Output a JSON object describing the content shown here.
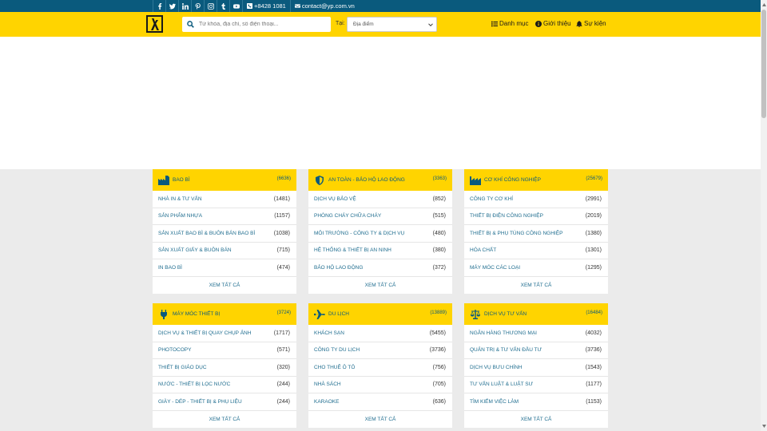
{
  "topbar": {
    "icons": [
      "facebook-icon",
      "twitter-icon",
      "linkedin-icon",
      "pinterest-icon",
      "instagram-icon",
      "tumblr-icon",
      "youtube-icon"
    ],
    "phone": "+8428 1081",
    "email": "contact@yp.com.vn",
    "bg_color": "#0a5a7d"
  },
  "header": {
    "bg_color": "#ffd400",
    "search_placeholder": "Từ khóa, địa chỉ, số điện thoại...",
    "location_label": "Tại:",
    "location_value": "Địa điểm",
    "nav": {
      "categories": "Danh mục",
      "about": "Giới thiệu",
      "events": "Sự kiện"
    }
  },
  "categories": [
    {
      "title": "BAO BÌ",
      "total": "(6636)",
      "icon": "factory-icon",
      "items": [
        {
          "label": "NHÀ IN & TƯ VẤN",
          "count": "(1481)"
        },
        {
          "label": "SẢN PHẨM NHỰA",
          "count": "(1157)"
        },
        {
          "label": "SẢN XUẤT BAO BÌ & BUÔN BÁN BAO BÌ",
          "count": "(1038)"
        },
        {
          "label": "SẢN XUẤT GIẤY & BUÔN BÁN",
          "count": "(715)"
        },
        {
          "label": "IN BAO BÌ",
          "count": "(474)"
        }
      ],
      "see_all": "XEM TẤT CẢ"
    },
    {
      "title": "AN TOÀN - BẢO HỘ LAO ĐỘNG",
      "total": "(3363)",
      "icon": "shield-icon",
      "items": [
        {
          "label": "DỊCH VỤ BẢO VỆ",
          "count": "(852)"
        },
        {
          "label": "PHÒNG CHÁY CHỮA CHÁY",
          "count": "(515)"
        },
        {
          "label": "MÔI TRƯỜNG - CÔNG TY & DỊCH VỤ",
          "count": "(480)"
        },
        {
          "label": "HỆ THỐNG & THIẾT BỊ AN NINH",
          "count": "(380)"
        },
        {
          "label": "BẢO HỘ LAO ĐỘNG",
          "count": "(372)"
        }
      ],
      "see_all": "XEM TẤT CẢ"
    },
    {
      "title": "CƠ KHÍ CÔNG NGHIỆP",
      "total": "(25679)",
      "icon": "industry-icon",
      "items": [
        {
          "label": "CÔNG TY CƠ KHÍ",
          "count": "(2991)"
        },
        {
          "label": "THIẾT BỊ ĐIỆN CÔNG NGHIỆP",
          "count": "(2019)"
        },
        {
          "label": "THIẾT BỊ & PHỤ TÙNG CÔNG NGHIỆP",
          "count": "(1380)"
        },
        {
          "label": "HÓA CHẤT",
          "count": "(1301)"
        },
        {
          "label": "MÁY MÓC CÁC LOẠI",
          "count": "(1295)"
        }
      ],
      "see_all": "XEM TẤT CẢ"
    },
    {
      "title": "MÁY MÓC THIẾT BỊ",
      "total": "(3724)",
      "icon": "plug-icon",
      "items": [
        {
          "label": "DỊCH VỤ & THIẾT BỊ QUAY CHỤP ẢNH",
          "count": "(1717)"
        },
        {
          "label": "PHOTOCOPY",
          "count": "(571)"
        },
        {
          "label": "THIẾT BỊ GIÁO DỤC",
          "count": "(320)"
        },
        {
          "label": "NƯỚC - THIẾT BỊ LỌC NƯỚC",
          "count": "(244)"
        },
        {
          "label": "GIÀY - DÉP - THIẾT BỊ & PHỤ LIỆU",
          "count": "(244)"
        }
      ],
      "see_all": "XEM TẤT CẢ"
    },
    {
      "title": "DU LỊCH",
      "total": "(13889)",
      "icon": "plane-icon",
      "items": [
        {
          "label": "KHÁCH SẠN",
          "count": "(5455)"
        },
        {
          "label": "CÔNG TY DU LỊCH",
          "count": "(3736)"
        },
        {
          "label": "CHO THUÊ Ô TÔ",
          "count": "(756)"
        },
        {
          "label": "NHÀ SÁCH",
          "count": "(705)"
        },
        {
          "label": "KARAOKE",
          "count": "(636)"
        }
      ],
      "see_all": "XEM TẤT CẢ"
    },
    {
      "title": "DỊCH VỤ TƯ VẤN",
      "total": "(16484)",
      "icon": "balance-scale-icon",
      "items": [
        {
          "label": "NGÂN HÀNG THƯƠNG MẠI",
          "count": "(4032)"
        },
        {
          "label": "QUẢN TRỊ & TƯ VẤN ĐẦU TƯ",
          "count": "(3736)"
        },
        {
          "label": "DỊCH VỤ BƯU CHÍNH",
          "count": "(1543)"
        },
        {
          "label": "TƯ VẤN LUẬT & LUẬT SƯ",
          "count": "(1177)"
        },
        {
          "label": "TÌM KIẾM VIỆC LÀM",
          "count": "(1153)"
        }
      ],
      "see_all": "XEM TẤT CẢ"
    }
  ]
}
